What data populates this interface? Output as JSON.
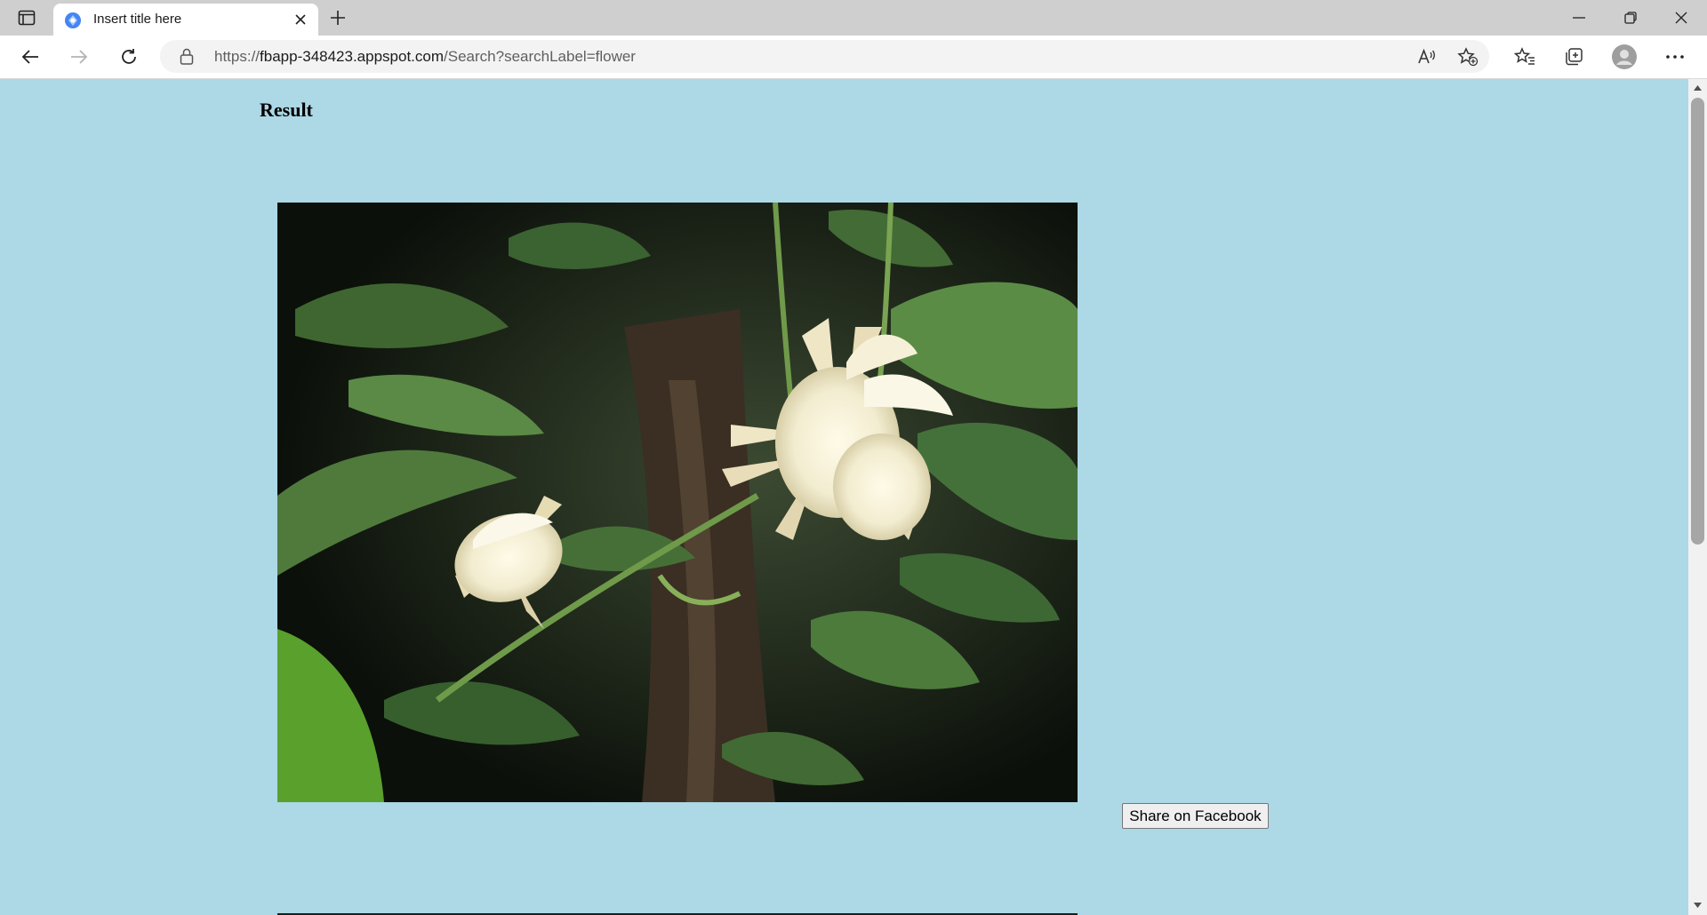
{
  "browser": {
    "tab_title": "Insert title here",
    "url_prefix": "https://",
    "url_host": "fbapp-348423.appspot.com",
    "url_path": "/Search?searchLabel=flower"
  },
  "page": {
    "heading": "Result",
    "share_button_label": "Share on Facebook",
    "background_color": "#add8e6"
  }
}
